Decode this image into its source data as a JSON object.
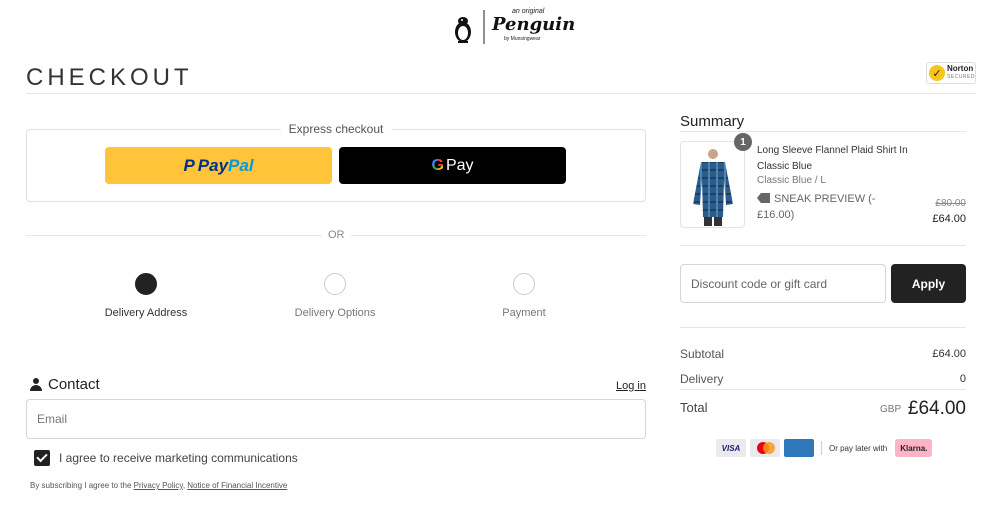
{
  "brand": {
    "logo_small": "an original",
    "logo_main": "Penguin",
    "logo_by": "by Munsingwear"
  },
  "header": {
    "title": "CHECKOUT",
    "norton_label": "Norton",
    "norton_sub": "SECURED"
  },
  "express": {
    "label": "Express checkout",
    "paypal_label_pay": "Pay",
    "paypal_label_pal": "Pal",
    "gpay_label": "Pay",
    "gpay_g": "G"
  },
  "divider": {
    "or": "OR"
  },
  "steps": [
    {
      "label": "Delivery Address",
      "active": true
    },
    {
      "label": "Delivery Options",
      "active": false
    },
    {
      "label": "Payment",
      "active": false
    }
  ],
  "contact": {
    "heading": "Contact",
    "login": "Log in",
    "email_placeholder": "Email",
    "marketing_label": "I agree to receive marketing communications",
    "marketing_checked": true,
    "fine_prefix": "By subscribing I agree to the",
    "privacy_link": "Privacy Policy",
    "notice_link": "Notice of Financial Incentive"
  },
  "summary": {
    "title": "Summary",
    "item": {
      "quantity": "1",
      "name": "Long Sleeve Flannel Plaid Shirt In Classic Blue",
      "variant": "Classic Blue / L",
      "tag": "SNEAK PREVIEW (-£16.00)",
      "price_old": "£80.00",
      "price_new": "£64.00"
    },
    "discount_placeholder": "Discount code or gift card",
    "apply_label": "Apply",
    "subtotal_label": "Subtotal",
    "subtotal_value": "£64.00",
    "delivery_label": "Delivery",
    "delivery_value": "0",
    "total_label": "Total",
    "total_currency": "GBP",
    "total_value": "£64.00",
    "payment_cards": [
      "VISA",
      "mastercard",
      "AMERICAN EXPRESS"
    ],
    "pay_later_label": "Or pay later with",
    "klarna_label": "Klarna."
  },
  "colors": {
    "paypal_yellow": "#ffc439",
    "paypal_blue": "#003087",
    "paypal_light_blue": "#009cde",
    "dark": "#222222",
    "klarna_pink": "#ffb3c7"
  }
}
